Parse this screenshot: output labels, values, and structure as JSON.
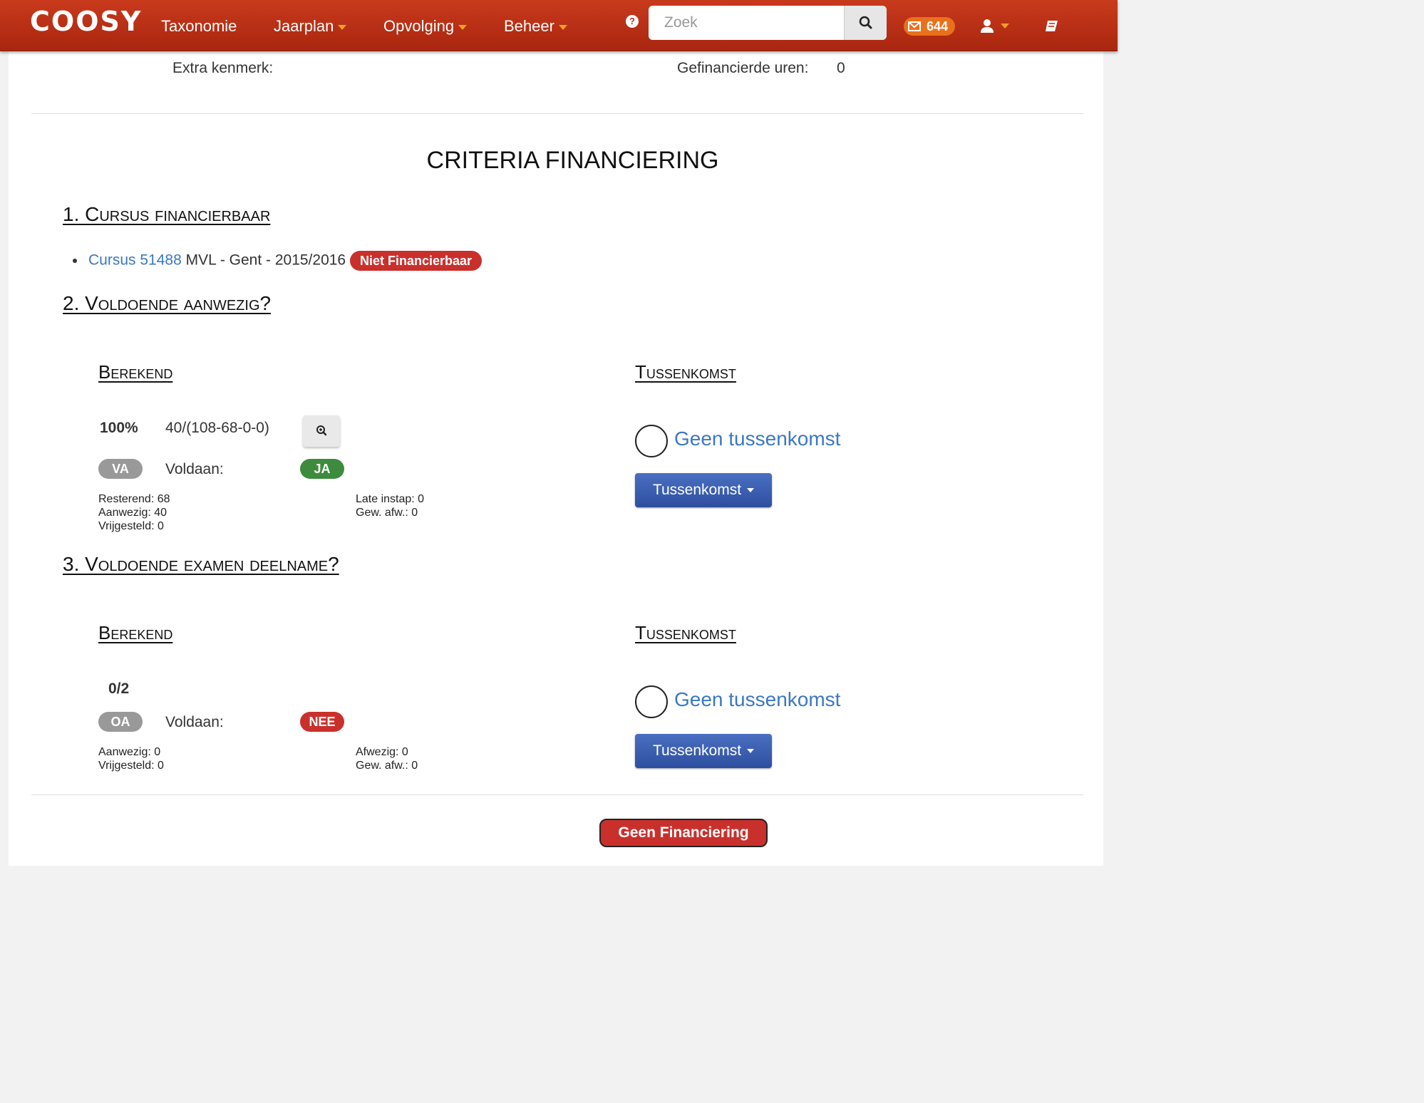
{
  "navbar": {
    "logo": "COOSY",
    "menu": [
      "Taxonomie",
      "Jaarplan",
      "Opvolging",
      "Beheer"
    ],
    "help": "?",
    "search_placeholder": "Zoek",
    "mail_count": "644"
  },
  "info": {
    "extra_label": "Extra kenmerk:",
    "hours_label": "Gefinancierde uren:",
    "hours_value": "0"
  },
  "title": "CRITERIA FINANCIERING",
  "section1": {
    "heading": "1. Cursus financierbaar",
    "course_link": "Cursus 51488",
    "course_text": "MVL - Gent - 2015/2016",
    "badge": "Niet Financierbaar"
  },
  "section2": {
    "heading": "2. Voldoende aanwezig?",
    "calc_heading": "Berekend",
    "inter_heading": "Tussenkomst",
    "percent": "100%",
    "formula": "40/(108-68-0-0)",
    "code_badge": "VA",
    "voldaan_label": "Voldaan:",
    "result_badge": "JA",
    "left_stats": [
      "Resterend: 68",
      "Aanwezig: 40",
      "Vrijgesteld: 0"
    ],
    "right_stats": [
      "Late instap: 0",
      "Gew. afw.: 0"
    ],
    "radio_label": "Geen tussenkomst",
    "dropdown_label": "Tussenkomst"
  },
  "section3": {
    "heading": "3. Voldoende examen deelname?",
    "calc_heading": "Berekend",
    "inter_heading": "Tussenkomst",
    "score": "0/2",
    "code_badge": "OA",
    "voldaan_label": "Voldaan:",
    "result_badge": "NEE",
    "left_stats": [
      "Aanwezig: 0",
      "Vrijgesteld: 0"
    ],
    "right_stats": [
      "Afwezig: 0",
      "Gew. afw.: 0"
    ],
    "radio_label": "Geen tussenkomst",
    "dropdown_label": "Tussenkomst"
  },
  "footer_button": "Geen Financiering",
  "colors": {
    "navbar": "#b5301a",
    "link": "#3a78c3",
    "badge_red": "#c9302c",
    "badge_green": "#3d8b3d",
    "button_blue": "#3a5bb0",
    "mail_badge": "#e9711c"
  },
  "icons": [
    "help-icon",
    "search-icon",
    "mail-icon",
    "user-icon",
    "book-icon",
    "zoom-icon"
  ]
}
